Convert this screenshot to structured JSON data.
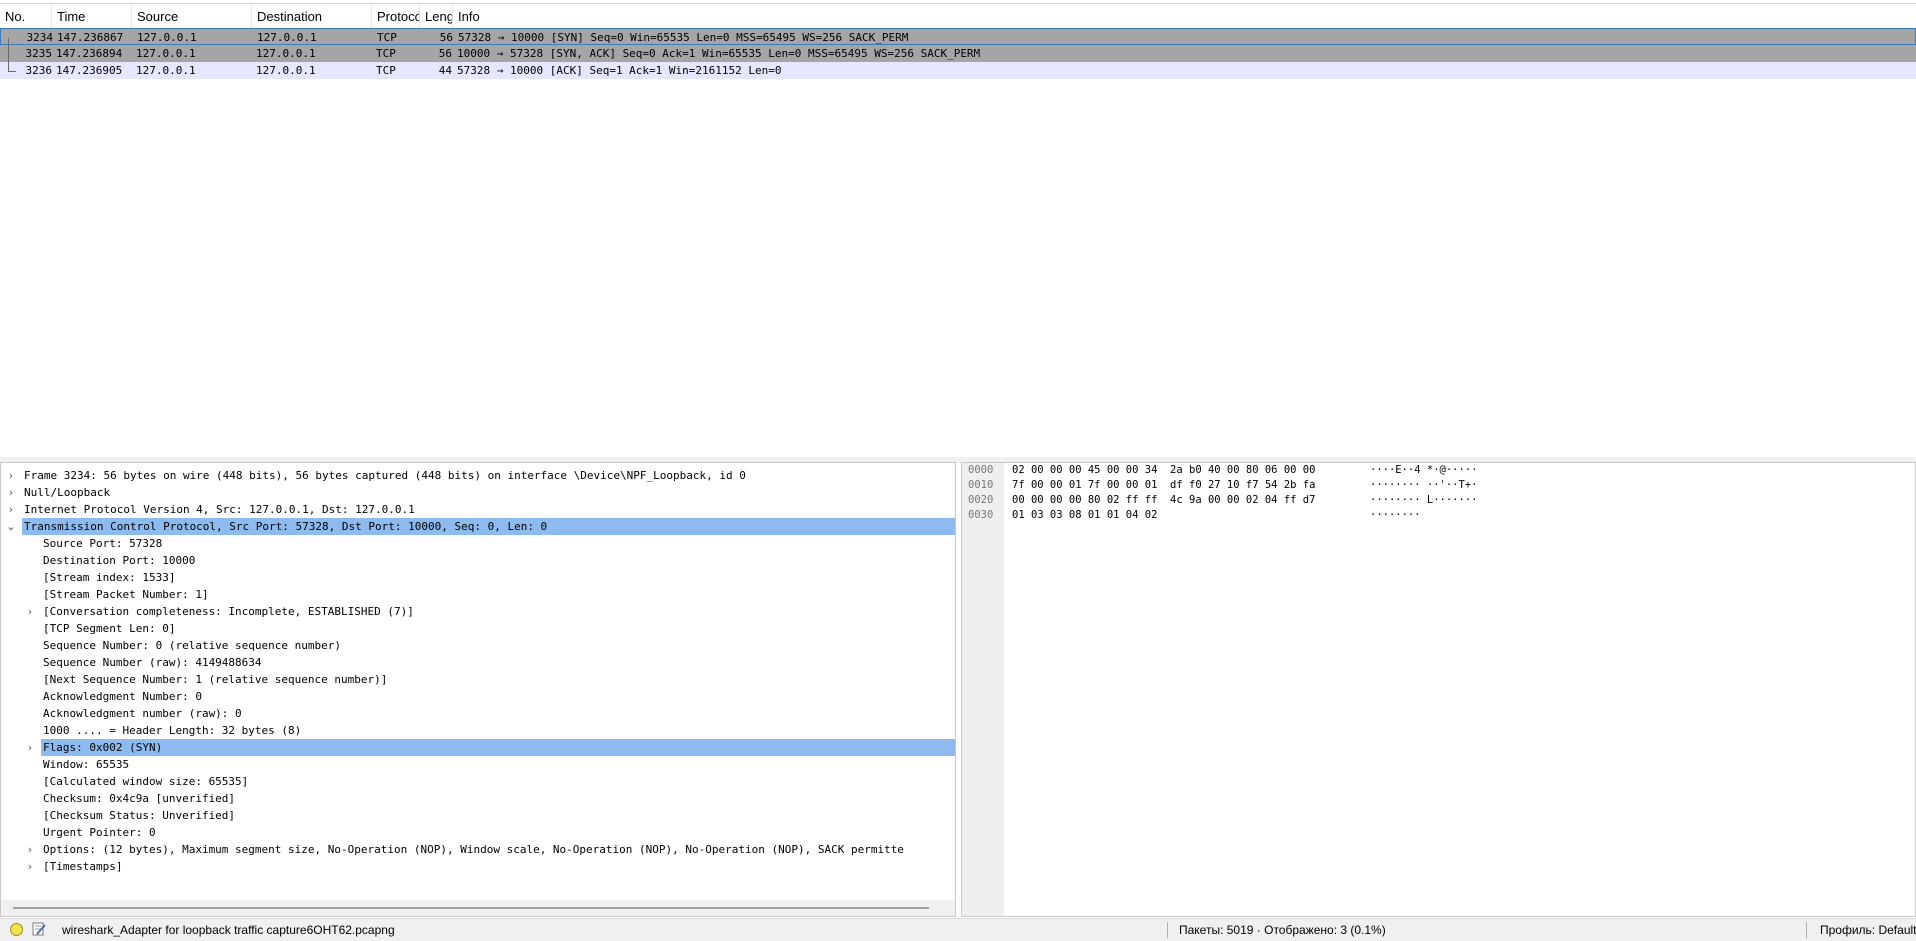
{
  "packet_list": {
    "columns": [
      "No.",
      "Time",
      "Source",
      "Destination",
      "Protocol",
      "Lengtl",
      "Info"
    ],
    "rows": [
      {
        "no": "3234",
        "time": "147.236867",
        "source": "127.0.0.1",
        "destination": "127.0.0.1",
        "protocol": "TCP",
        "length": "56",
        "info": "57328 → 10000 [SYN] Seq=0 Win=65535 Len=0 MSS=65495 WS=256 SACK_PERM",
        "selected": true
      },
      {
        "no": "3235",
        "time": "147.236894",
        "source": "127.0.0.1",
        "destination": "127.0.0.1",
        "protocol": "TCP",
        "length": "56",
        "info": "10000 → 57328 [SYN, ACK] Seq=0 Ack=1 Win=65535 Len=0 MSS=65495 WS=256 SACK_PERM"
      },
      {
        "no": "3236",
        "time": "147.236905",
        "source": "127.0.0.1",
        "destination": "127.0.0.1",
        "protocol": "TCP",
        "length": "44",
        "info": "57328 → 10000 [ACK] Seq=1 Ack=1 Win=2161152 Len=0"
      }
    ]
  },
  "details": {
    "rows": [
      {
        "text": "Frame 3234: 56 bytes on wire (448 bits), 56 bytes captured (448 bits) on interface \\Device\\NPF_Loopback, id 0",
        "level": 0,
        "expander": "collapsed"
      },
      {
        "text": "Null/Loopback",
        "level": 0,
        "expander": "collapsed"
      },
      {
        "text": "Internet Protocol Version 4, Src: 127.0.0.1, Dst: 127.0.0.1",
        "level": 0,
        "expander": "collapsed"
      },
      {
        "text": "Transmission Control Protocol, Src Port: 57328, Dst Port: 10000, Seq: 0, Len: 0",
        "level": 0,
        "expander": "expanded",
        "highlight": true
      },
      {
        "text": "Source Port: 57328",
        "level": 1,
        "expander": "none"
      },
      {
        "text": "Destination Port: 10000",
        "level": 1,
        "expander": "none"
      },
      {
        "text": "[Stream index: 1533]",
        "level": 1,
        "expander": "none"
      },
      {
        "text": "[Stream Packet Number: 1]",
        "level": 1,
        "expander": "none"
      },
      {
        "text": "[Conversation completeness: Incomplete, ESTABLISHED (7)]",
        "level": 1,
        "expander": "collapsed"
      },
      {
        "text": "[TCP Segment Len: 0]",
        "level": 1,
        "expander": "none"
      },
      {
        "text": "Sequence Number: 0    (relative sequence number)",
        "level": 1,
        "expander": "none"
      },
      {
        "text": "Sequence Number (raw): 4149488634",
        "level": 1,
        "expander": "none"
      },
      {
        "text": "[Next Sequence Number: 1    (relative sequence number)]",
        "level": 1,
        "expander": "none"
      },
      {
        "text": "Acknowledgment Number: 0",
        "level": 1,
        "expander": "none"
      },
      {
        "text": "Acknowledgment number (raw): 0",
        "level": 1,
        "expander": "none"
      },
      {
        "text": "1000 .... = Header Length: 32 bytes (8)",
        "level": 1,
        "expander": "none"
      },
      {
        "text": "Flags: 0x002 (SYN)",
        "level": 1,
        "expander": "collapsed",
        "highlight": true
      },
      {
        "text": "Window: 65535",
        "level": 1,
        "expander": "none"
      },
      {
        "text": "[Calculated window size: 65535]",
        "level": 1,
        "expander": "none"
      },
      {
        "text": "Checksum: 0x4c9a [unverified]",
        "level": 1,
        "expander": "none"
      },
      {
        "text": "[Checksum Status: Unverified]",
        "level": 1,
        "expander": "none"
      },
      {
        "text": "Urgent Pointer: 0",
        "level": 1,
        "expander": "none"
      },
      {
        "text": "Options: (12 bytes), Maximum segment size, No-Operation (NOP), Window scale, No-Operation (NOP), No-Operation (NOP), SACK permitte",
        "level": 1,
        "expander": "collapsed"
      },
      {
        "text": "[Timestamps]",
        "level": 1,
        "expander": "collapsed"
      }
    ]
  },
  "bytes": {
    "rows": [
      {
        "offset": "0000",
        "hex": "02 00 00 00 45 00 00 34  2a b0 40 00 80 06 00 00",
        "ascii": "····E··4 *·@·····"
      },
      {
        "offset": "0010",
        "hex": "7f 00 00 01 7f 00 00 01  df f0 27 10 f7 54 2b fa",
        "ascii": "········ ··'··T+·"
      },
      {
        "offset": "0020",
        "hex": "00 00 00 00 80 02 ff ff  4c 9a 00 00 02 04 ff d7",
        "ascii": "········ L·······"
      },
      {
        "offset": "0030",
        "hex": "01 03 03 08 01 01 04 02",
        "ascii": "········"
      }
    ]
  },
  "statusbar": {
    "file": "wireshark_Adapter for loopback traffic capture6OHT62.pcapng",
    "packets": "Пакеты: 5019 · Отображено: 3 (0.1%)",
    "profile": "Профиль: Default"
  },
  "colors": {
    "selected_row_bg": "#a5a5a5",
    "selected_row_border": "#3d7bbf",
    "ack_row_bg": "#e7e6ff",
    "detail_highlight": "#8dbbf0",
    "status_icon": "#f2e24a"
  }
}
